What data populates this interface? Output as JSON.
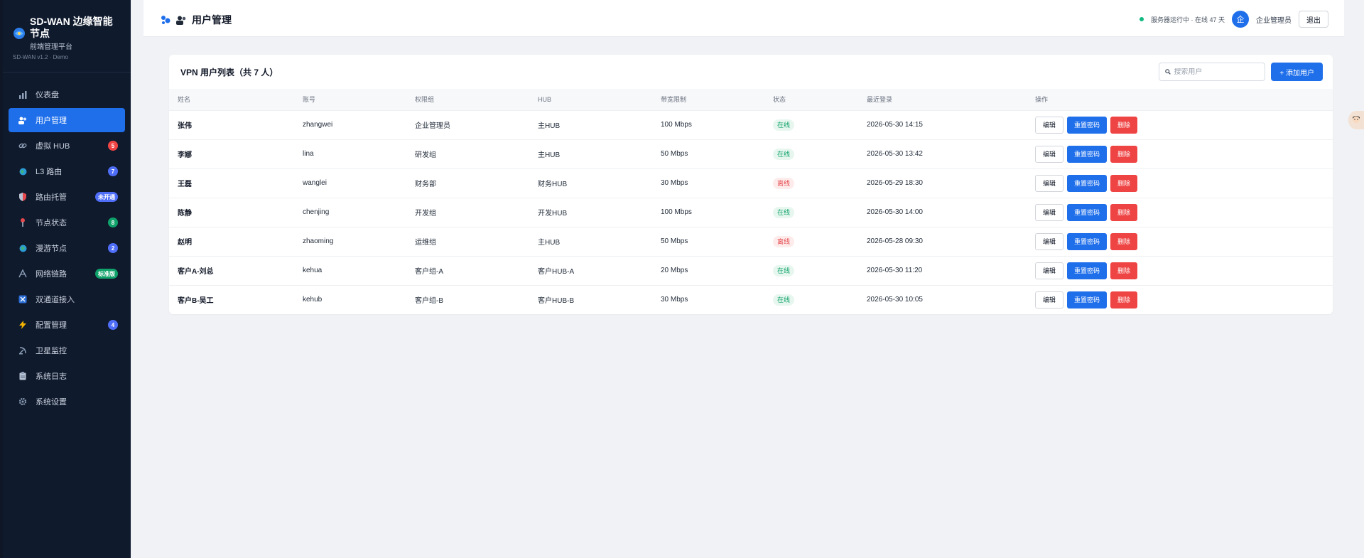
{
  "sidebar": {
    "brand_title": "SD-WAN 边缘智能节点",
    "brand_subtitle": "前端管理平台",
    "version": "SD-WAN v1.2 · Demo",
    "items": [
      {
        "label": "仪表盘",
        "icon": "chart-icon",
        "badge": ""
      },
      {
        "label": "用户管理",
        "icon": "users-icon",
        "badge": "",
        "active": true
      },
      {
        "label": "虚拟 HUB",
        "icon": "link-icon",
        "badge": "5",
        "badge_color": "#ef4444"
      },
      {
        "label": "L3 路由",
        "icon": "globe-icon",
        "badge": "7",
        "badge_color": "#4f6ef7"
      },
      {
        "label": "路由托管",
        "icon": "shield-icon",
        "badge": "未开通",
        "badge_color": "#4f6ef7"
      },
      {
        "label": "节点状态",
        "icon": "pin-icon",
        "badge": "8",
        "badge_color": "#10a26b"
      },
      {
        "label": "漫游节点",
        "icon": "globe-icon",
        "badge": "2",
        "badge_color": "#4f6ef7"
      },
      {
        "label": "网络链路",
        "icon": "antenna-icon",
        "badge": "标准版",
        "badge_color": "#10a26b"
      },
      {
        "label": "双通道接入",
        "icon": "dual-icon",
        "badge": ""
      },
      {
        "label": "配置管理",
        "icon": "bolt-icon",
        "badge": "4",
        "badge_color": "#4f6ef7"
      },
      {
        "label": "卫星监控",
        "icon": "satellite-icon",
        "badge": ""
      },
      {
        "label": "系统日志",
        "icon": "clipboard-icon",
        "badge": ""
      },
      {
        "label": "系统设置",
        "icon": "gear-icon",
        "badge": ""
      }
    ]
  },
  "topbar": {
    "title": "用户管理",
    "status_text": "服务器运行中 · 在线 47 天",
    "avatar_text": "企",
    "user_name": "企业管理员",
    "logout_label": "退出"
  },
  "card": {
    "title": "VPN 用户列表（共 7 人）",
    "search_placeholder": "搜索用户",
    "add_label": "+ 添加用户",
    "columns": [
      "姓名",
      "账号",
      "权限组",
      "HUB",
      "带宽限制",
      "状态",
      "最近登录",
      "操作"
    ],
    "rows": [
      {
        "name": "张伟",
        "account": "zhangwei",
        "group": "企业管理员",
        "hub": "主HUB",
        "bw": "100 Mbps",
        "status": "在线",
        "online": true,
        "last": "2026-05-30 14:15"
      },
      {
        "name": "李娜",
        "account": "lina",
        "group": "研发组",
        "hub": "主HUB",
        "bw": "50 Mbps",
        "status": "在线",
        "online": true,
        "last": "2026-05-30 13:42"
      },
      {
        "name": "王磊",
        "account": "wanglei",
        "group": "财务部",
        "hub": "财务HUB",
        "bw": "30 Mbps",
        "status": "离线",
        "online": false,
        "last": "2026-05-29 18:30"
      },
      {
        "name": "陈静",
        "account": "chenjing",
        "group": "开发组",
        "hub": "开发HUB",
        "bw": "100 Mbps",
        "status": "在线",
        "online": true,
        "last": "2026-05-30 14:00"
      },
      {
        "name": "赵明",
        "account": "zhaoming",
        "group": "运维组",
        "hub": "主HUB",
        "bw": "50 Mbps",
        "status": "离线",
        "online": false,
        "last": "2026-05-28 09:30"
      },
      {
        "name": "客户A-刘总",
        "account": "kehua",
        "group": "客户组-A",
        "hub": "客户HUB-A",
        "bw": "20 Mbps",
        "status": "在线",
        "online": true,
        "last": "2026-05-30 11:20"
      },
      {
        "name": "客户B-吴工",
        "account": "kehub",
        "group": "客户组-B",
        "hub": "客户HUB-B",
        "bw": "30 Mbps",
        "status": "在线",
        "online": true,
        "last": "2026-05-30 10:05"
      }
    ],
    "actions": {
      "edit": "编辑",
      "reset": "重置密码",
      "delete": "删除"
    }
  },
  "colors": {
    "accent": "#1f6feb",
    "sidebar_bg": "#0f1a2d",
    "danger": "#ef4444",
    "success": "#10a26b"
  }
}
